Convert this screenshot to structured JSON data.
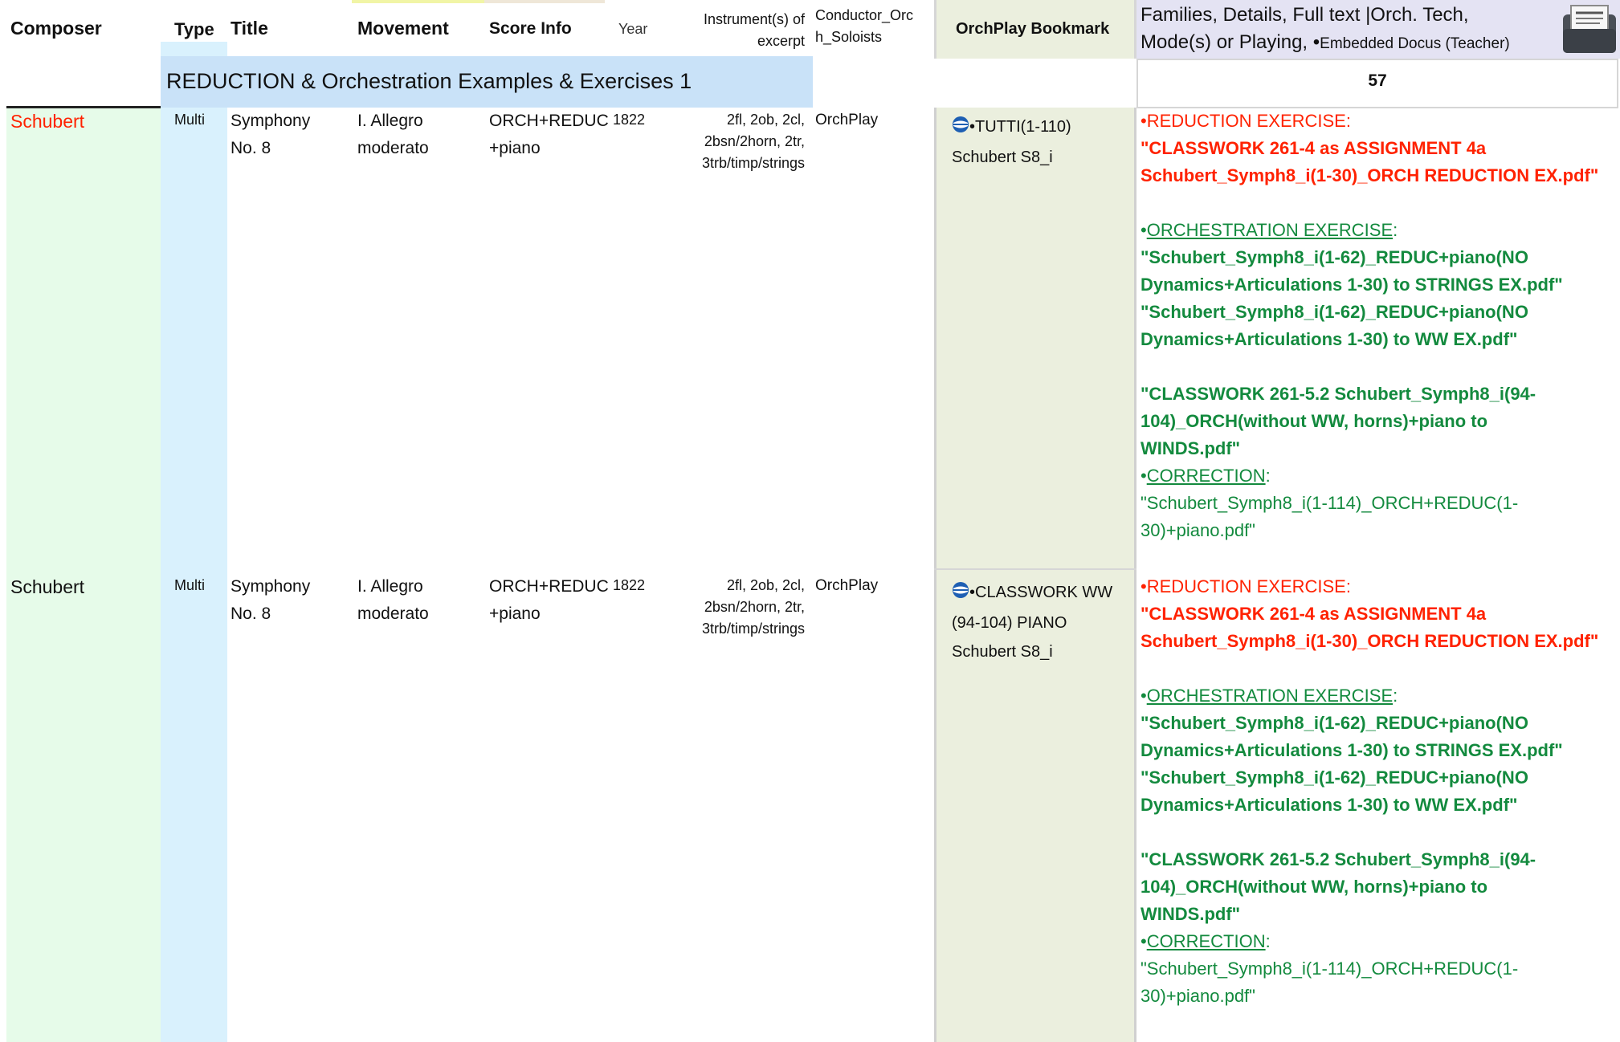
{
  "headers": {
    "composer": "Composer",
    "type": "Type",
    "title": "Title",
    "movement": "Movement",
    "score_info": "Score Info",
    "year": "Year",
    "instruments_1": "Instrument(s) of",
    "instruments_2": "excerpt",
    "conductor_1": "Conductor_Orc",
    "conductor_2": "h_Soloists",
    "orchplay": "OrchPlay Bookmark",
    "families_1": "Families, Details, Full text |Orch. Tech,",
    "families_2": "Mode(s) or Playing,",
    "families_bullet": "•",
    "families_3": "Embedded Docus (Teacher)"
  },
  "section": {
    "title": "REDUCTION & Orchestration Examples & Exercises 1",
    "count": "57"
  },
  "rows": [
    {
      "composer": "Schubert",
      "type": "Multi",
      "title_1": "Symphony",
      "title_2": "No. 8",
      "movement_1": "I. Allegro",
      "movement_2": "moderato",
      "score_1": "ORCH+REDUC",
      "score_2": "+piano",
      "year": "1822",
      "instr_1": "2fl, 2ob, 2cl,",
      "instr_2": "2bsn/2horn, 2tr,",
      "instr_3": "3trb/timp/strings",
      "conductor": "OrchPlay",
      "bookmark_1": "•TUTTI(1-110)",
      "bookmark_2": "Schubert S8_i",
      "bookmark_3": "",
      "reduc_label": "•REDUCTION EXERCISE:",
      "reduc_1": "\"CLASSWORK 261-4 as ASSIGNMENT 4a",
      "reduc_2": "Schubert_Symph8_i(1-30)_ORCH REDUCTION EX.pdf\"",
      "orch_bullet": "•",
      "orch_label": "ORCHESTRATION EXERCISE",
      "orch_colon": ":",
      "orch_1": "\"Schubert_Symph8_i(1-62)_REDUC+piano(NO",
      "orch_2": "Dynamics+Articulations 1-30) to STRINGS EX.pdf\"",
      "orch_3": "\"Schubert_Symph8_i(1-62)_REDUC+piano(NO",
      "orch_4": "Dynamics+Articulations 1-30) to WW EX.pdf\"",
      "cw_1": "\"CLASSWORK 261-5.2 Schubert_Symph8_i(94-",
      "cw_2": "104)_ORCH(without WW, horns)+piano to",
      "cw_3": "WINDS.pdf\"",
      "corr_bullet": "•",
      "corr_label": "CORRECTION",
      "corr_colon": ":",
      "corr_1": "\"Schubert_Symph8_i(1-114)_ORCH+REDUC(1-",
      "corr_2": "30)+piano.pdf\""
    },
    {
      "composer": "Schubert",
      "type": "Multi",
      "title_1": "Symphony",
      "title_2": "No. 8",
      "movement_1": "I. Allegro",
      "movement_2": "moderato",
      "score_1": "ORCH+REDUC",
      "score_2": "+piano",
      "year": "1822",
      "instr_1": "2fl, 2ob, 2cl,",
      "instr_2": "2bsn/2horn, 2tr,",
      "instr_3": "3trb/timp/strings",
      "conductor": "OrchPlay",
      "bookmark_1": "•CLASSWORK WW",
      "bookmark_2": "(94-104) PIANO",
      "bookmark_3": "Schubert S8_i",
      "reduc_label": "•REDUCTION EXERCISE:",
      "reduc_1": "\"CLASSWORK 261-4 as ASSIGNMENT 4a",
      "reduc_2": "Schubert_Symph8_i(1-30)_ORCH REDUCTION EX.pdf\"",
      "orch_bullet": "•",
      "orch_label": "ORCHESTRATION EXERCISE",
      "orch_colon": ":",
      "orch_1": "\"Schubert_Symph8_i(1-62)_REDUC+piano(NO",
      "orch_2": "Dynamics+Articulations 1-30) to STRINGS EX.pdf\"",
      "orch_3": "\"Schubert_Symph8_i(1-62)_REDUC+piano(NO",
      "orch_4": "Dynamics+Articulations 1-30) to WW EX.pdf\"",
      "cw_1": "\"CLASSWORK 261-5.2 Schubert_Symph8_i(94-",
      "cw_2": "104)_ORCH(without WW, horns)+piano to",
      "cw_3": "WINDS.pdf\"",
      "corr_bullet": "•",
      "corr_label": "CORRECTION",
      "corr_colon": ":",
      "corr_1": "\"Schubert_Symph8_i(1-114)_ORCH+REDUC(1-",
      "corr_2": "30)+piano.pdf\""
    }
  ],
  "colors": {
    "composer_col": "#e6fbe9",
    "type_col": "#d9f1fd",
    "section_band": "#c9e2f8",
    "orchplay_col": "#ebefde",
    "families_header": "#e4e3f3",
    "first_composer": "#ff2200",
    "green_text": "#138a3e",
    "red_text": "#ff2200"
  },
  "icons": {
    "row_icon": "orchplay-globe-icon",
    "header_icon": "embedded-document-icon"
  }
}
